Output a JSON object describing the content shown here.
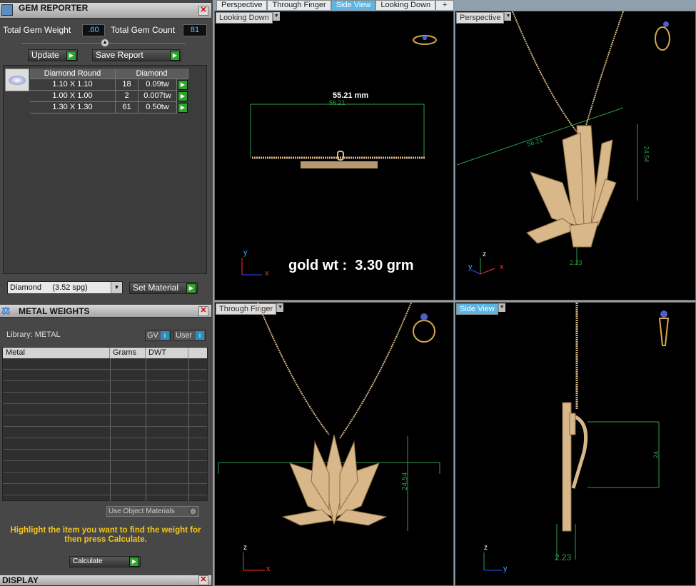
{
  "gem_reporter": {
    "title": "GEM REPORTER",
    "total_gem_weight_label": "Total Gem Weight",
    "total_gem_weight_value": ".60",
    "total_gem_count_label": "Total Gem Count",
    "total_gem_count_value": "81",
    "update_label": "Update",
    "save_report_label": "Save Report",
    "table_headers": [
      "Diamond Round",
      "Diamond"
    ],
    "rows": [
      {
        "size": "1.10 X 1.10",
        "count": "18",
        "weight": "0.09tw"
      },
      {
        "size": "1.00 X 1.00",
        "count": "2",
        "weight": "0.007tw"
      },
      {
        "size": "1.30 X 1.30",
        "count": "61",
        "weight": "0.50tw"
      }
    ],
    "material_select": "Diamond     (3.52 spg)",
    "set_material_label": "Set Material"
  },
  "metal_weights": {
    "title": "METAL WEIGHTS",
    "library_label": "Library: METAL",
    "gv_label": "GV",
    "user_label": "User",
    "columns": [
      "Metal",
      "Grams",
      "DWT"
    ],
    "use_object_materials_label": "Use Object Materials",
    "instruction": "Highlight the item you want to find the weight for then press Calculate.",
    "calculate_label": "Calculate"
  },
  "display": {
    "title": "DISPLAY"
  },
  "tabs": [
    "Perspective",
    "Through Finger",
    "Side View",
    "Looking Down"
  ],
  "active_tab_index": 2,
  "viewports": {
    "top_left": {
      "label": "Looking Down",
      "dimension_main": "55.21 mm",
      "dimension_small": "56.21",
      "gold_weight": "gold wt :  3.30 grm",
      "axis1": "y",
      "axis2": "x"
    },
    "top_right": {
      "label": "Perspective",
      "dim_a": "56.21",
      "dim_b": "24.54",
      "dim_c": "2.23",
      "axis1": "z",
      "axis2": "y",
      "axis3": "x"
    },
    "bottom_left": {
      "label": "Through Finger",
      "dim_a": "24.54",
      "axis1": "z",
      "axis2": "x"
    },
    "bottom_right": {
      "label": "Side View",
      "dim_a": "2.23",
      "dim_b": "24",
      "axis1": "z",
      "axis2": "y"
    }
  },
  "colors": {
    "gold": "#d8b88a",
    "accent": "#5bb6e6",
    "dim": "#2f9e4a"
  }
}
